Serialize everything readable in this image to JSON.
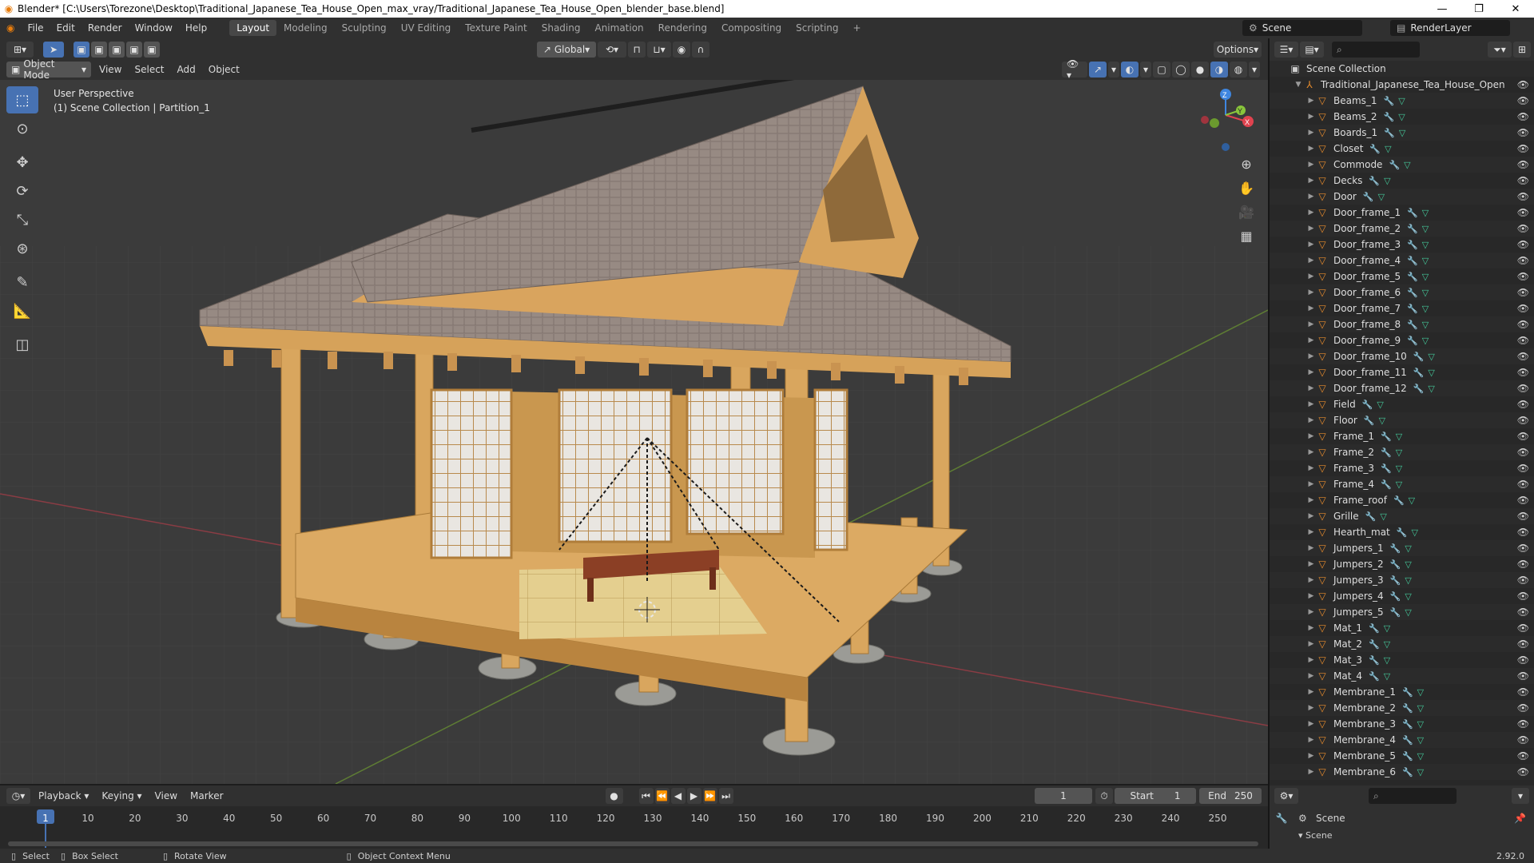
{
  "window": {
    "title": "Blender* [C:\\Users\\Torezone\\Desktop\\Traditional_Japanese_Tea_House_Open_max_vray/Traditional_Japanese_Tea_House_Open_blender_base.blend]"
  },
  "menu": [
    "File",
    "Edit",
    "Render",
    "Window",
    "Help"
  ],
  "workspaces": [
    "Layout",
    "Modeling",
    "Sculpting",
    "UV Editing",
    "Texture Paint",
    "Shading",
    "Animation",
    "Rendering",
    "Compositing",
    "Scripting"
  ],
  "active_workspace": "Layout",
  "scene_name": "Scene",
  "view_layer": "RenderLayer",
  "viewport": {
    "mode": "Object Mode",
    "menus": [
      "View",
      "Select",
      "Add",
      "Object"
    ],
    "orientation": "Global",
    "options_label": "Options",
    "perspective_label": "User Perspective",
    "collection_label": "(1) Scene Collection | Partition_1"
  },
  "gizmo": {
    "x": "X",
    "y": "Y",
    "z": "Z"
  },
  "outliner": {
    "root": "Scene Collection",
    "collection": "Traditional_Japanese_Tea_House_Open",
    "items": [
      "Beams_1",
      "Beams_2",
      "Boards_1",
      "Closet",
      "Commode",
      "Decks",
      "Door",
      "Door_frame_1",
      "Door_frame_2",
      "Door_frame_3",
      "Door_frame_4",
      "Door_frame_5",
      "Door_frame_6",
      "Door_frame_7",
      "Door_frame_8",
      "Door_frame_9",
      "Door_frame_10",
      "Door_frame_11",
      "Door_frame_12",
      "Field",
      "Floor",
      "Frame_1",
      "Frame_2",
      "Frame_3",
      "Frame_4",
      "Frame_roof",
      "Grille",
      "Hearth_mat",
      "Jumpers_1",
      "Jumpers_2",
      "Jumpers_3",
      "Jumpers_4",
      "Jumpers_5",
      "Mat_1",
      "Mat_2",
      "Mat_3",
      "Mat_4",
      "Membrane_1",
      "Membrane_2",
      "Membrane_3",
      "Membrane_4",
      "Membrane_5",
      "Membrane_6"
    ]
  },
  "timeline": {
    "menus": [
      "Playback",
      "Keying",
      "View",
      "Marker"
    ],
    "current_frame": "1",
    "start_label": "Start",
    "start": "1",
    "end_label": "End",
    "end": "250",
    "ticks": [
      "1",
      "10",
      "20",
      "30",
      "40",
      "50",
      "60",
      "70",
      "80",
      "90",
      "100",
      "110",
      "120",
      "130",
      "140",
      "150",
      "160",
      "170",
      "180",
      "190",
      "200",
      "210",
      "220",
      "230",
      "240",
      "250"
    ]
  },
  "properties": {
    "scene": "Scene",
    "panel": "Scene"
  },
  "status": {
    "select": "Select",
    "box_select": "Box Select",
    "rotate": "Rotate View",
    "context": "Object Context Menu",
    "version": "2.92.0"
  },
  "colors": {
    "accent": "#4772b3",
    "object_orange": "#e88c2c",
    "mesh_green": "#44c89a",
    "axis_x": "#e0434f",
    "axis_y": "#88c53b",
    "axis_z": "#3f86e0"
  }
}
